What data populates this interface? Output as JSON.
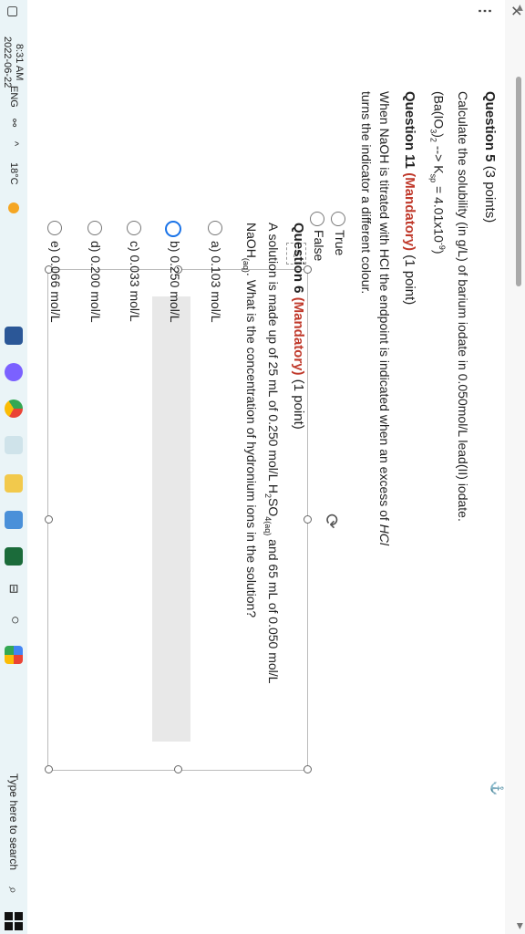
{
  "browser": {
    "close_glyph": "✕",
    "more_glyph": "⋮"
  },
  "question5": {
    "title": "Question 5",
    "points": "(3 points)",
    "text": "Calculate the solubility (in g/L) of barium iodate in 0.050mol/L lead(II) iodate.",
    "formula_a": "(Ba(IO",
    "formula_sub1": "3",
    "formula_b": ")",
    "formula_sub2": "2",
    "formula_c": " --> K",
    "formula_sub3": "sp",
    "formula_d": " = 4.01x10",
    "formula_sup": "-9",
    "formula_e": ")"
  },
  "question11": {
    "title": "Question 11",
    "mandatory": "(Mandatory)",
    "points": "(1 point)",
    "text_line1": "When NaOH is titrated with HCl the endpoint is indicated when an excess of",
    "text_hcl": "HCl",
    "text_line2": "turns the indicator a different colour.",
    "options": [
      "True",
      "False"
    ]
  },
  "question6": {
    "title": "Question 6",
    "mandatory": "(Mandatory)",
    "points": "(1 point)",
    "line1_a": "A solution is made up of 25 mL of 0.250 mol/L H",
    "line1_sub1": "2",
    "line1_b": "SO",
    "line1_sub2": "4(aq)",
    "line1_c": " and 65 mL of 0.050 mol/L",
    "line2_a": "NaOH",
    "line2_sub": "(aq)",
    "line2_b": ". What is the concentration of hydronium ions in the solution?",
    "options": [
      "a) 0.103 mol/L",
      "b) 0.250 mol/L",
      "c) 0.033 mol/L",
      "d) 0.200 mol/L",
      "e) 0.066 mol/L"
    ],
    "selected_index": 1
  },
  "taskbar": {
    "search_placeholder": "Type here to search",
    "weather": "18°C",
    "language": "ENG",
    "time": "8:31 AM",
    "date": "2022-06-22",
    "icons": [
      "search-icon",
      "task-view-icon",
      "widgets-icon",
      "file-explorer-icon",
      "paint-icon",
      "chrome-icon",
      "app-icon",
      "word-icon"
    ],
    "colors": {
      "accent": "#1a73e8",
      "mandatory": "#c0392b",
      "taskbar_bg": "#eaf4f7"
    }
  }
}
